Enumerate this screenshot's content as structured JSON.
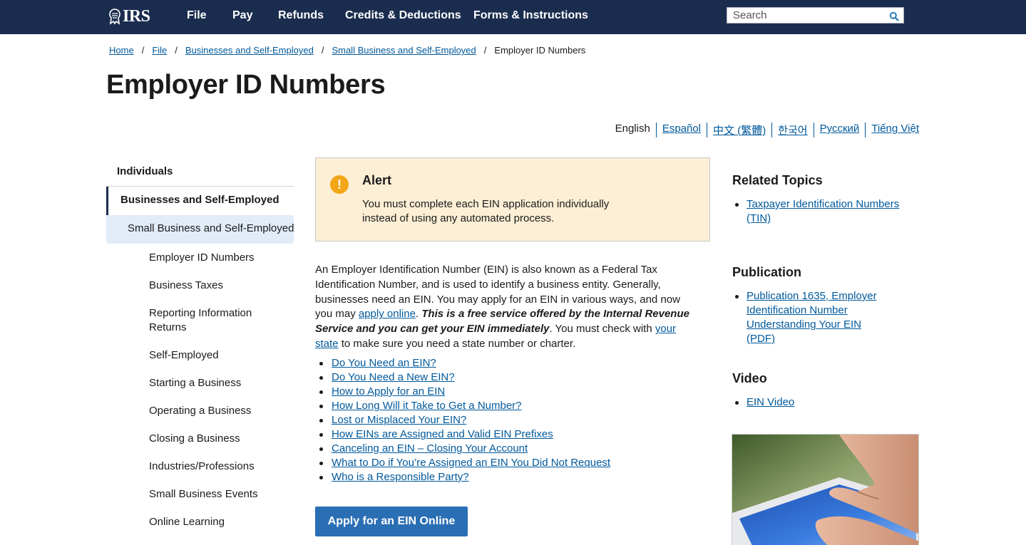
{
  "header": {
    "logo_text": "IRS",
    "nav": [
      "File",
      "Pay",
      "Refunds",
      "Credits & Deductions",
      "Forms & Instructions"
    ],
    "search_placeholder": "Search"
  },
  "breadcrumb": {
    "links": [
      "Home",
      "File",
      "Businesses and Self-Employed",
      "Small Business and Self-Employed"
    ],
    "separator": "/",
    "current": "Employer ID Numbers"
  },
  "page_title": "Employer ID Numbers",
  "languages": {
    "active": "English",
    "links": [
      "Español",
      "中文 (繁體)",
      "한국어",
      "Русский",
      "Tiếng Việt"
    ]
  },
  "sidebar": {
    "top": "Individuals",
    "section": "Businesses and Self-Employed",
    "subsection": "Small Business and Self-Employed",
    "items": [
      "Employer ID Numbers",
      "Business Taxes",
      "Reporting Information Returns",
      "Self-Employed",
      "Starting a Business",
      "Operating a Business",
      "Closing a Business",
      "Industries/Professions",
      "Small Business Events",
      "Online Learning"
    ]
  },
  "alert": {
    "title": "Alert",
    "text": "You must complete each EIN application individually instead of using any automated process."
  },
  "intro": {
    "text_1": "An Employer Identification Number (EIN) is also known as a Federal Tax Identification Number, and is used to identify a business entity. Generally, businesses need an EIN. You may apply for an EIN in various ways, and now you may ",
    "link_1": "apply online",
    "text_2": ". ",
    "bold": "This is a free service offered by the Internal Revenue Service and you can get your EIN immediately",
    "text_3": ". You must check with ",
    "link_2": "your state",
    "text_4": " to make sure you need a state number or charter."
  },
  "links": [
    "Do You Need an EIN?",
    "Do You Need a New EIN?",
    "How to Apply for an EIN",
    "How Long Will it Take to Get a Number?",
    "Lost or Misplaced Your EIN?",
    "How EINs are Assigned and Valid EIN Prefixes",
    "Canceling an EIN – Closing Your Account",
    "What to Do if You’re Assigned an EIN You Did Not Request",
    "Who is a Responsible Party?"
  ],
  "apply_button": "Apply for an EIN Online",
  "related": {
    "topics_head": "Related Topics",
    "topics": [
      "Taxpayer Identification Numbers (TIN)"
    ],
    "publication_head": "Publication",
    "publications": [
      "Publication 1635, Employer Identification Number Understanding Your EIN (PDF)"
    ],
    "video_head": "Video",
    "videos": [
      "EIN Video"
    ]
  },
  "colors": {
    "header_bg": "#1b2d4f",
    "link": "#00599c",
    "alert_bg": "#fdefd6",
    "alert_icon": "#f2a618",
    "button": "#2a6eb4",
    "sidebar_active_bg": "#e1ecf7"
  }
}
